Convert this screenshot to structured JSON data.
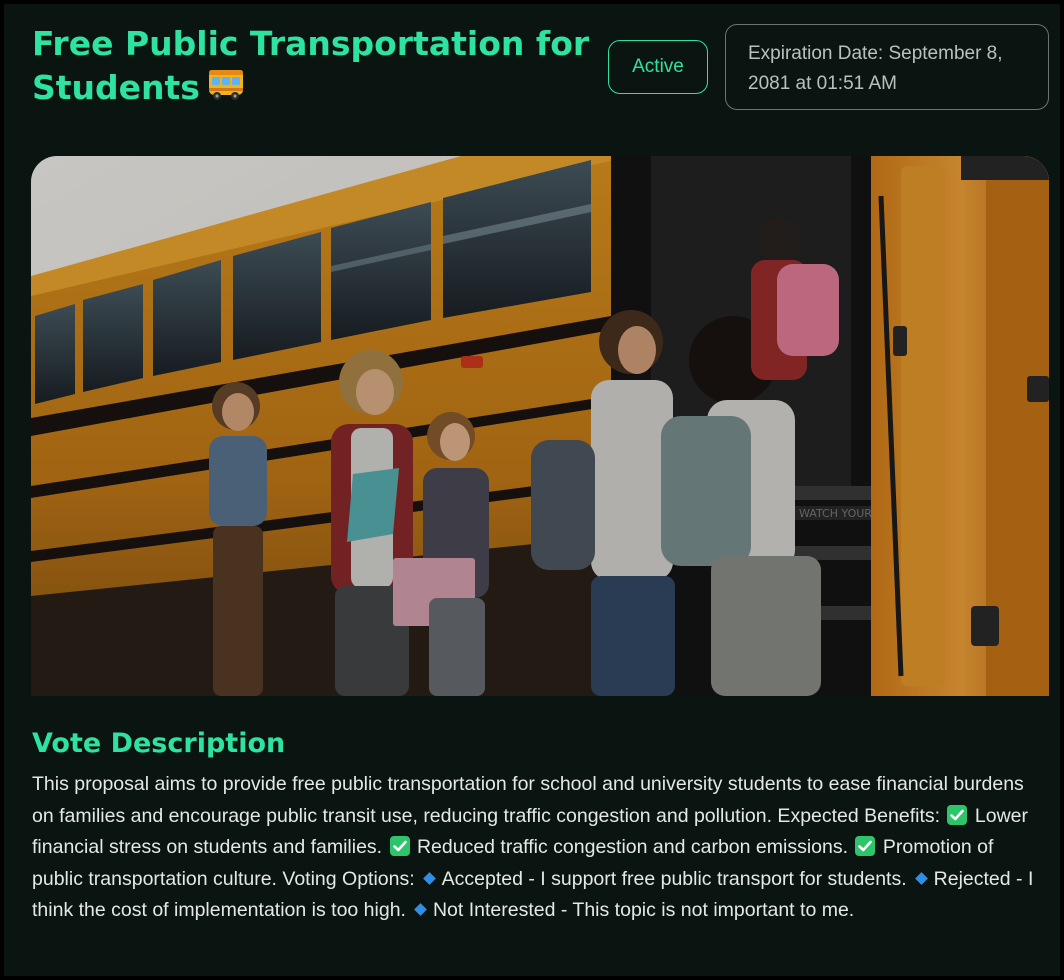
{
  "header": {
    "title": "Free Public Transportation for Students",
    "title_emoji": "bus-icon",
    "status": "Active",
    "expiration": "Expiration Date: September 8, 2081 at 01:51 AM"
  },
  "hero_image": {
    "subject": "children-boarding-school-bus",
    "bus_sign": "WATCH YOUR ST"
  },
  "description": {
    "heading": "Vote Description",
    "intro": "This proposal aims to provide free public transportation for school and university students to ease financial burdens on families and encourage public transit use, reducing traffic congestion and pollution. Expected Benefits:",
    "benefits": [
      "Lower financial stress on students and families.",
      "Reduced traffic congestion and carbon emissions.",
      "Promotion of public transportation culture."
    ],
    "options_label": "Voting Options:",
    "options": [
      "Accepted - I support free public transport for students.",
      "Rejected - I think the cost of implementation is too high.",
      "Not Interested - This topic is not important to me."
    ]
  },
  "colors": {
    "accent": "#2ee3a0",
    "background": "#0a1512",
    "check_icon": "#2ec46b",
    "diamond_icon": "#2f8fe8",
    "bus_yellow": "#e0951e"
  }
}
